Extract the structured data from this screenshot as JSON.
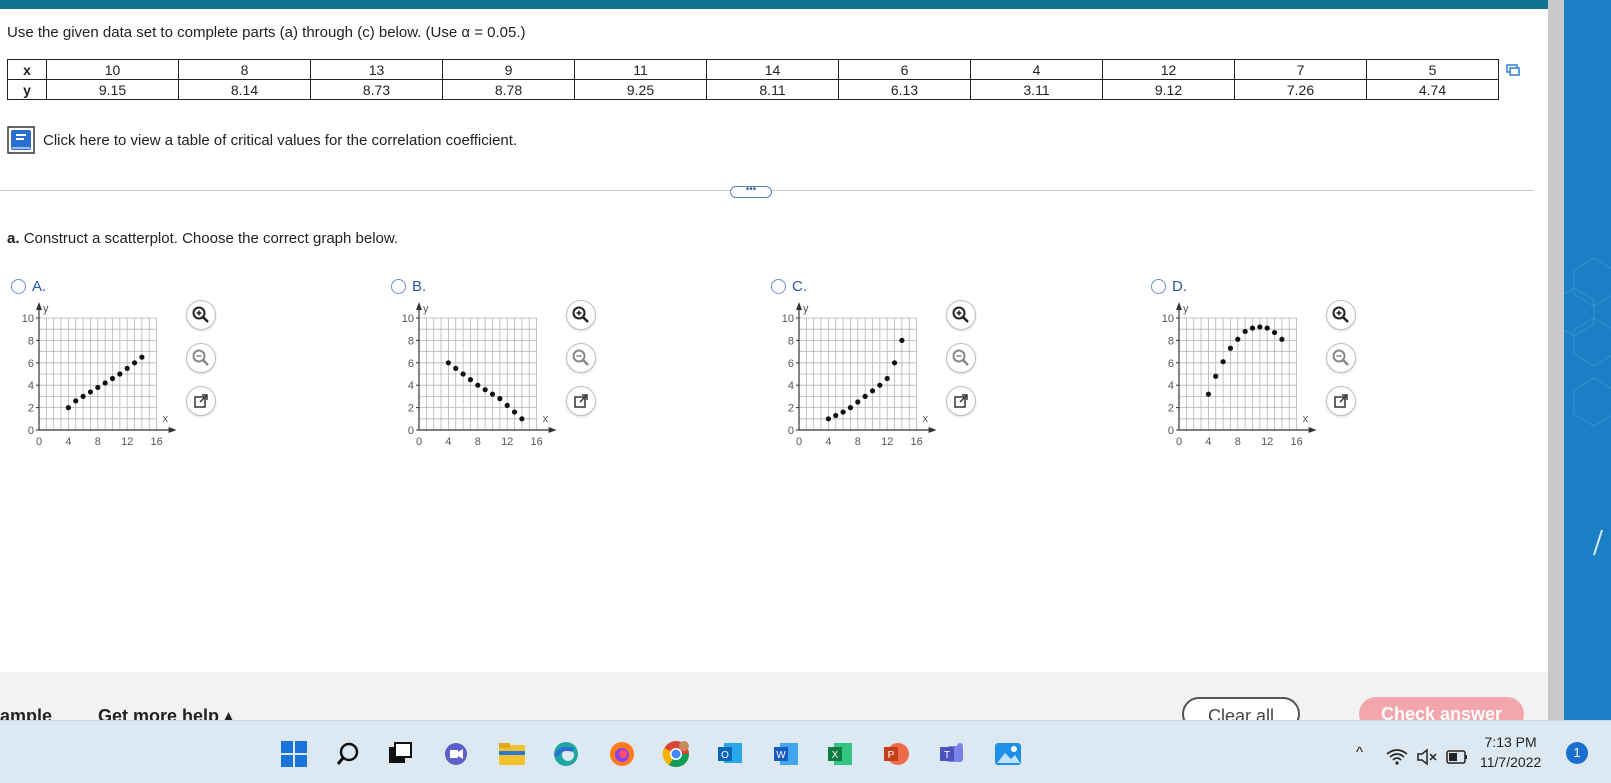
{
  "header": {
    "instructions": "Use the given data set to complete parts (a) through (c) below. (Use α = 0.05.)"
  },
  "data_table": {
    "x_label": "x",
    "y_label": "y",
    "x": [
      "10",
      "8",
      "13",
      "9",
      "11",
      "14",
      "6",
      "4",
      "12",
      "7",
      "5"
    ],
    "y": [
      "9.15",
      "8.14",
      "8.73",
      "8.78",
      "9.25",
      "8.11",
      "6.13",
      "3.11",
      "9.12",
      "7.26",
      "4.74"
    ]
  },
  "critical_values_link": "Click here to view a table of critical values for the correlation coefficient.",
  "more_button": "•••",
  "question": {
    "part": "a.",
    "text": "Construct a scatterplot. Choose the correct graph below."
  },
  "options": [
    {
      "label": "A.",
      "points": [
        [
          4,
          2
        ],
        [
          5,
          2.6
        ],
        [
          6,
          3
        ],
        [
          7,
          3.4
        ],
        [
          8,
          3.8
        ],
        [
          9,
          4.2
        ],
        [
          10,
          4.6
        ],
        [
          11,
          5
        ],
        [
          12,
          5.5
        ],
        [
          13,
          6
        ],
        [
          14,
          6.5
        ]
      ]
    },
    {
      "label": "B.",
      "points": [
        [
          4,
          6
        ],
        [
          5,
          5.5
        ],
        [
          6,
          5
        ],
        [
          7,
          4.5
        ],
        [
          8,
          4
        ],
        [
          9,
          3.6
        ],
        [
          10,
          3.2
        ],
        [
          11,
          2.8
        ],
        [
          12,
          2.2
        ],
        [
          13,
          1.6
        ],
        [
          14,
          1
        ]
      ]
    },
    {
      "label": "C.",
      "points": [
        [
          4,
          1
        ],
        [
          5,
          1.3
        ],
        [
          6,
          1.6
        ],
        [
          7,
          2
        ],
        [
          8,
          2.5
        ],
        [
          9,
          3
        ],
        [
          10,
          3.5
        ],
        [
          11,
          4
        ],
        [
          12,
          4.6
        ],
        [
          13,
          6
        ],
        [
          14,
          8
        ]
      ]
    },
    {
      "label": "D.",
      "points": [
        [
          4,
          3.2
        ],
        [
          5,
          4.8
        ],
        [
          6,
          6.1
        ],
        [
          7,
          7.3
        ],
        [
          8,
          8.1
        ],
        [
          9,
          8.8
        ],
        [
          10,
          9.1
        ],
        [
          11,
          9.2
        ],
        [
          12,
          9.1
        ],
        [
          13,
          8.7
        ],
        [
          14,
          8.1
        ]
      ]
    }
  ],
  "graph_axes": {
    "x_name": "x",
    "y_name": "y",
    "x_ticks": [
      "0",
      "4",
      "8",
      "12",
      "16"
    ],
    "y_ticks": [
      "0",
      "2",
      "4",
      "6",
      "8",
      "10"
    ]
  },
  "footer": {
    "left_text": "ample",
    "help_text": "Get more help ▴",
    "clear_all": "Clear all",
    "check_answer": "Check answer"
  },
  "taskbar": {
    "time": "7:13 PM",
    "date": "11/7/2022",
    "notification_count": "1",
    "tray_chevron": "^"
  },
  "colors": {
    "top_bar": "#0f7390",
    "option_blue": "#2d59a8",
    "check_button": "#f4a6ad",
    "right_panel": "#1a7fc4"
  }
}
